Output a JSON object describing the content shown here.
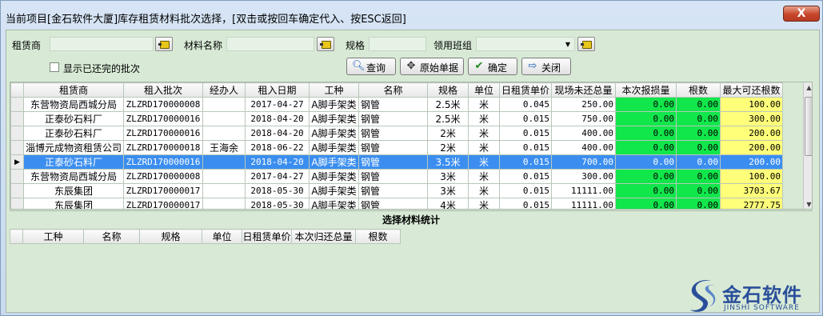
{
  "window": {
    "title": "当前项目[金石软件大厦]库存租赁材料批次选择，[双击或按回车确定代入、按ESC返回]",
    "close_label": "X"
  },
  "filters": {
    "lessor_label": "租赁商",
    "lessor_value": "",
    "material_label": "材料名称",
    "material_value": "",
    "spec_label": "规格",
    "spec_value": "",
    "team_label": "领用班组",
    "team_value": "",
    "show_returned_label": "显示已还完的批次",
    "show_returned_checked": false
  },
  "toolbar": {
    "query_label": "查询",
    "original_label": "原始单据",
    "confirm_label": "确定",
    "close_label": "关闭"
  },
  "grid": {
    "columns": [
      "租赁商",
      "租入批次",
      "经办人",
      "租入日期",
      "工种",
      "名称",
      "规格",
      "单位",
      "日租赁单价",
      "现场未还总量",
      "本次报损量",
      "根数",
      "最大可还根数"
    ],
    "rows": [
      [
        "东营物资局西城分局",
        "ZLZRD170000008",
        "",
        "2017-04-27",
        "A脚手架类",
        "钢管",
        "2.5米",
        "米",
        "0.045",
        "250.00",
        "0.00",
        "0.00",
        "100.00"
      ],
      [
        "正泰砂石料厂",
        "ZLZRD170000016",
        "",
        "2018-04-20",
        "A脚手架类",
        "钢管",
        "2.5米",
        "米",
        "0.015",
        "750.00",
        "0.00",
        "0.00",
        "300.00"
      ],
      [
        "正泰砂石料厂",
        "ZLZRD170000016",
        "",
        "2018-04-20",
        "A脚手架类",
        "钢管",
        "2米",
        "米",
        "0.015",
        "400.00",
        "0.00",
        "0.00",
        "200.00"
      ],
      [
        "淄博元成物资租赁公司",
        "ZLZRD170000018",
        "王海余",
        "2018-06-22",
        "A脚手架类",
        "钢管",
        "2米",
        "米",
        "0.015",
        "400.00",
        "0.00",
        "0.00",
        "200.00"
      ],
      [
        "正泰砂石料厂",
        "ZLZRD170000016",
        "",
        "2018-04-20",
        "A脚手架类",
        "钢管",
        "3.5米",
        "米",
        "0.015",
        "700.00",
        "0.00",
        "0.00",
        "200.00"
      ],
      [
        "东营物资局西城分局",
        "ZLZRD170000008",
        "",
        "2017-04-27",
        "A脚手架类",
        "钢管",
        "3米",
        "米",
        "0.015",
        "300.00",
        "0.00",
        "0.00",
        "100.00"
      ],
      [
        "东辰集团",
        "ZLZRD170000017",
        "",
        "2018-05-30",
        "A脚手架类",
        "钢管",
        "3米",
        "米",
        "0.015",
        "11111.00",
        "0.00",
        "0.00",
        "3703.67"
      ],
      [
        "东辰集团",
        "ZLZRD170000017",
        "",
        "2018-05-30",
        "A脚手架类",
        "钢管",
        "4米",
        "米",
        "0.015",
        "11111.00",
        "0.00",
        "0.00",
        "2777.75"
      ]
    ],
    "selected_row": 4
  },
  "summary": {
    "title": "选择材料统计",
    "columns": [
      "工种",
      "名称",
      "规格",
      "单位",
      "日租赁单价",
      "本次归还总量",
      "根数"
    ]
  },
  "logo": {
    "name_cn": "金石软件",
    "name_en": "JINSHI SOFTWARE"
  }
}
